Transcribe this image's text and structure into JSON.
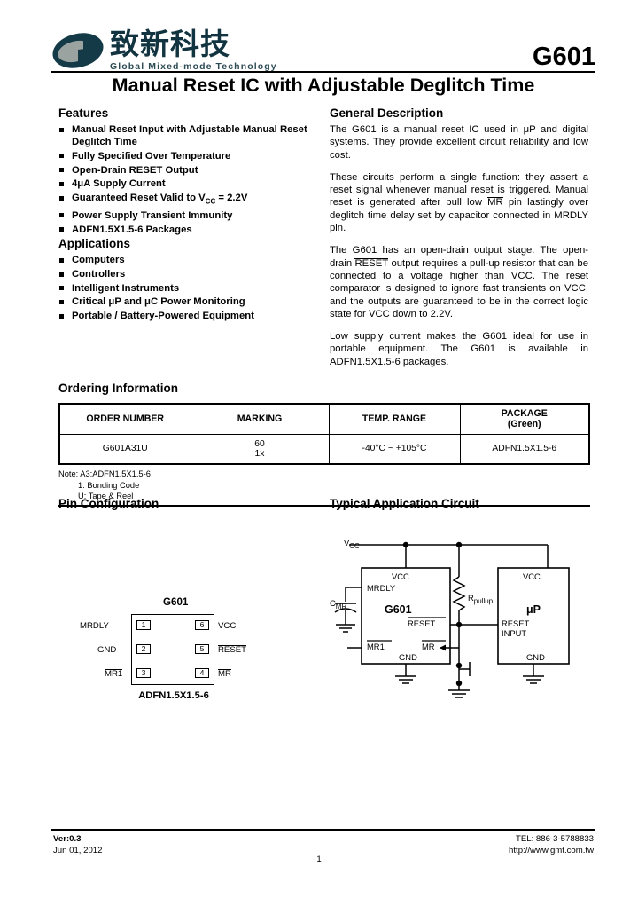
{
  "header": {
    "logo_icon": "gmt-ellipse-logo",
    "company_cn": "致新科技",
    "tagline": "Global Mixed-mode Technology",
    "part_number": "G601",
    "doc_title": "Manual Reset IC with Adjustable Deglitch Time",
    "logo_color_outer": "#143a47",
    "logo_color_inner": "#9aa39f",
    "brand_color": "#123440"
  },
  "features": {
    "heading": "Features",
    "items": [
      "Manual Reset Input with Adjustable Manual Reset Deglitch Time",
      "Fully Specified Over Temperature",
      "Open-Drain  RESET Output",
      "4μA Supply Current",
      "Guaranteed Reset Valid to VCC = 2.2V",
      "Power Supply Transient Immunity",
      "ADFN1.5X1.5-6 Packages"
    ]
  },
  "applications": {
    "heading": "Applications",
    "items": [
      "Computers",
      "Controllers",
      "Intelligent Instruments",
      "Critical μP and μC Power Monitoring",
      "Portable / Battery-Powered Equipment"
    ]
  },
  "general_description": {
    "heading": "General Description",
    "paragraphs": [
      "The G601 is a manual reset IC used in μP and digital systems. They provide excellent circuit reliability and low cost.",
      "These circuits perform a single function: they assert a reset signal whenever manual reset is triggered. Manual reset is generated after pull low MR pin lastingly over deglitch time delay set by capacitor connected in MRDLY pin.",
      "The G601 has an open-drain output stage. The open-drain RESET output requires a pull-up resistor that can be connected to a voltage higher than VCC. The reset comparator is designed to ignore fast transients on VCC, and the outputs are guaranteed to be in the correct logic state for VCC down to 2.2V.",
      "Low supply current makes the G601 ideal for use in portable equipment. The G601 is available in ADFN1.5X1.5-6 packages."
    ]
  },
  "ordering": {
    "heading": "Ordering Information",
    "columns": [
      "ORDER NUMBER",
      "MARKING",
      "TEMP. RANGE",
      "PACKAGE\n(Green)"
    ],
    "col_package_line1": "PACKAGE",
    "col_package_line2": "(Green)",
    "rows": [
      {
        "order_number": "G601A31U",
        "marking_line1": "60",
        "marking_line2": "1x",
        "temp_range": "-40°C ~ +105°C",
        "package": "ADFN1.5X1.5-6"
      }
    ],
    "notes": [
      "Note: A3:ADFN1.5X1.5-6",
      "1: Bonding Code",
      "U: Tape & Reel"
    ]
  },
  "pin_configuration": {
    "heading": "Pin Configuration",
    "device_label": "G601",
    "package_label": "ADFN1.5X1.5-6",
    "pins_left": [
      {
        "number": "1",
        "name": "MRDLY",
        "overline": false
      },
      {
        "number": "2",
        "name": "GND",
        "overline": false
      },
      {
        "number": "3",
        "name": "MR1",
        "overline": true
      }
    ],
    "pins_right": [
      {
        "number": "6",
        "name": "VCC",
        "overline": false
      },
      {
        "number": "5",
        "name": "RESET",
        "overline": true
      },
      {
        "number": "4",
        "name": "MR",
        "overline": true
      }
    ]
  },
  "application_circuit": {
    "heading": "Typical Application Circuit",
    "rail_label": "VCC",
    "cap_label": "C",
    "cap_sub": "MR",
    "res_label": "R",
    "res_sub": "pullup",
    "ic_label": "G601",
    "ic_vcc": "VCC",
    "ic_mrdly": "MRDLY",
    "ic_reset": "RESET",
    "ic_mr1": "MR1",
    "ic_mr": "MR",
    "ic_gnd": "GND",
    "mcu_label": "μP",
    "mcu_vcc": "VCC",
    "mcu_reset_line1": "RESET",
    "mcu_reset_line2": "INPUT",
    "mcu_gnd": "GND"
  },
  "footer": {
    "version": "Ver:0.3",
    "date": "Jun 01, 2012",
    "tel": "TEL: 886-3-5788833",
    "website": "http://www.gmt.com.tw",
    "page_number": "1"
  }
}
